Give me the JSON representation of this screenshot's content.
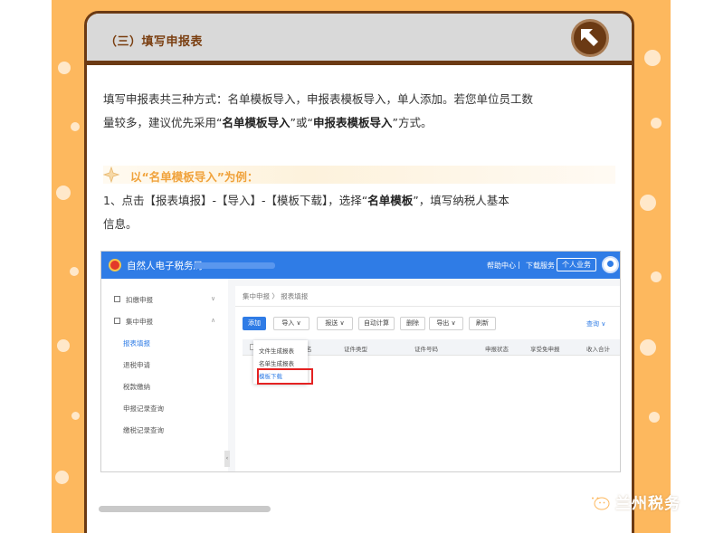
{
  "article": {
    "section_title": "（三）填写申报表",
    "paragraph1_a": "填写申报表共三种方式：名单模板导入，申报表模板导入，单人添加。若您单位员工数",
    "paragraph1_b_pre": "量较多，建议优先采用“",
    "paragraph1_b_bold1": "名单模板导入",
    "paragraph1_b_mid": "”或“",
    "paragraph1_b_bold2": "申报表模板导入",
    "paragraph1_b_post": "”方式。",
    "subheading": "以“名单模板导入”为例：",
    "step1_a": "1、点击【报表填报】-【导入】-【模板下载】，选择“",
    "step1_bold": "名单模板",
    "step1_b": "”，填写纳税人基本",
    "step1_c": "信息。"
  },
  "screenshot": {
    "app_title": "自然人电子税务局",
    "help_center": "帮助中心",
    "separator": "|",
    "download_service": "下载服务",
    "personal_business": "个人业务",
    "sidebar": {
      "items": [
        {
          "label": "扣缴申报"
        },
        {
          "label": "集中申报"
        },
        {
          "label": "报表填报"
        },
        {
          "label": "退税申请"
        },
        {
          "label": "税款缴纳"
        },
        {
          "label": "申报记录查询"
        },
        {
          "label": "缴税记录查询"
        }
      ]
    },
    "breadcrumb": "集中申报  〉 报表填报",
    "toolbar": {
      "add": "添加",
      "import": "导入 ∨",
      "submit": "报送 ∨",
      "auto_calc": "自动计算",
      "delete": "删除",
      "export": "导出 ∨",
      "refresh": "刷新",
      "query": "查询 ∨"
    },
    "table_headers": [
      "名",
      "证件类型",
      "证件号码",
      "申报状态",
      "享受免申报",
      "收入合计"
    ],
    "dropdown": {
      "items": [
        "文件生成报表",
        "名单生成报表",
        "模板下载"
      ]
    }
  },
  "watermark": "兰州税务",
  "colors": {
    "orange_bg": "#fdb85e",
    "card_border": "#6b3a14",
    "title_color": "#7a3e10",
    "subheading_color": "#f0a23b",
    "portal_blue": "#2f7ce6",
    "highlight_red": "#e42222"
  },
  "icons": {
    "back": "arrow-up-left-icon",
    "subheading": "sparkle-icon",
    "watermark": "wechat-icon"
  }
}
